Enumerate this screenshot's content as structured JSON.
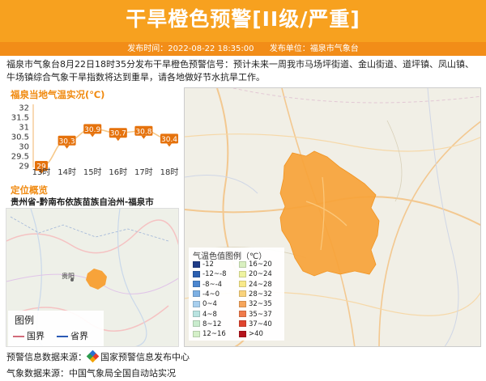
{
  "header": {
    "title": "干旱橙色预警[II级/严重]",
    "publish_time": "发布时间：2022-08-22 18:35:00",
    "publish_unit": "发布单位：福泉市气象台"
  },
  "description": "福泉市气象台8月22日18时35分发布干旱橙色预警信号：预计未来一周我市马场坪街道、金山街道、道坪镇、凤山镇、牛场镇综合气象干旱指数将达到重旱，请各地做好节水抗旱工作。",
  "temp_panel": {
    "title": "福泉当地气温实况(℃)"
  },
  "chart_data": {
    "type": "line",
    "title": "福泉当地气温实况(℃)",
    "categories": [
      "13时",
      "14时",
      "15时",
      "16时",
      "17时",
      "18时"
    ],
    "values": [
      29,
      30.3,
      30.9,
      30.7,
      30.8,
      30.4
    ],
    "value_labels": [
      "29",
      "30.3",
      "30.9",
      "30.7",
      "30.8",
      "30.4"
    ],
    "y_ticks": [
      "32",
      "31.5",
      "31",
      "30.5",
      "30",
      "29.5",
      "29"
    ],
    "ylim": [
      29,
      32
    ],
    "line_color": "#f7c98a",
    "label_color": "#e5720c",
    "grid": false
  },
  "location": {
    "title": "定位概览",
    "name": "贵州省-黔南布依族苗族自治州-福泉市",
    "city_label": "贵阳",
    "legend": {
      "title": "图例",
      "national_border": "国界",
      "provincial_border": "省界"
    }
  },
  "temp_legend": {
    "title": "气温色值图例（℃）",
    "items": [
      {
        "label": "-12",
        "color": "#1f3c88"
      },
      {
        "label": "16~20",
        "color": "#d9f0c0"
      },
      {
        "label": "-12~-8",
        "color": "#2c5fb0"
      },
      {
        "label": "20~24",
        "color": "#eef3a0"
      },
      {
        "label": "-8~-4",
        "color": "#4b86cf"
      },
      {
        "label": "24~28",
        "color": "#f8e98a"
      },
      {
        "label": "-4~0",
        "color": "#7db0e3"
      },
      {
        "label": "28~32",
        "color": "#f9d27a"
      },
      {
        "label": "0~4",
        "color": "#a8cfee"
      },
      {
        "label": "32~35",
        "color": "#f6a55b"
      },
      {
        "label": "4~8",
        "color": "#b9e3e0"
      },
      {
        "label": "35~37",
        "color": "#f07a4a"
      },
      {
        "label": "8~12",
        "color": "#c9eccd"
      },
      {
        "label": "37~40",
        "color": "#e0442e"
      },
      {
        "label": "12~16",
        "color": "#d4f0c8"
      },
      {
        "label": ">40",
        "color": "#b5141d"
      }
    ]
  },
  "footer": {
    "warning_source": "预警信息数据来源：",
    "warning_source_name": "国家预警信息发布中心",
    "weather_source": "气象数据来源：中国气象局全国自动站实况"
  },
  "colors": {
    "header": "#f7a11f",
    "subbar": "#f28d18",
    "accent": "#f08a10",
    "region_fill": "#f7a33a"
  }
}
